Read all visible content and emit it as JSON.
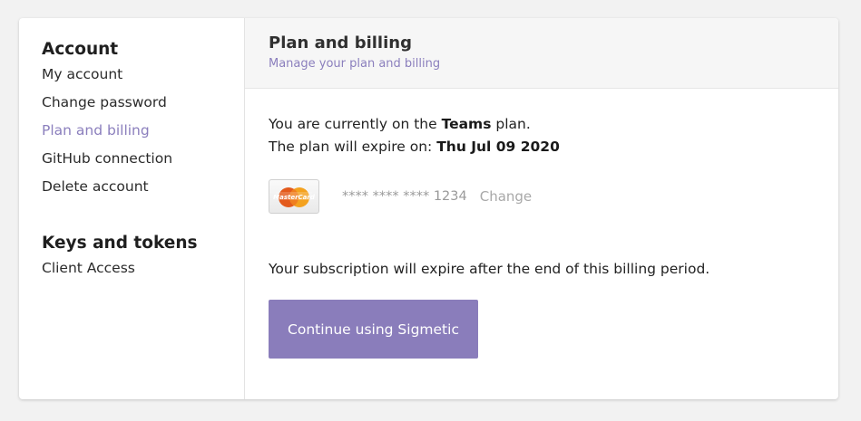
{
  "sidebar": {
    "account_heading": "Account",
    "account_items": [
      "My account",
      "Change password",
      "Plan and billing",
      "GitHub connection",
      "Delete account"
    ],
    "active_item": "Plan and billing",
    "keys_heading": "Keys and tokens",
    "keys_items": [
      "Client Access"
    ]
  },
  "main": {
    "title": "Plan and billing",
    "subtitle": "Manage your plan and billing",
    "plan_prefix": "You are currently on the ",
    "plan_name": "Teams",
    "plan_suffix": " plan.",
    "expire_prefix": "The plan will expire on: ",
    "expire_date": "Thu Jul 09 2020",
    "card_brand_text": "MasterCard",
    "card_number": "**** **** **** 1234",
    "card_change": "Change",
    "subscription_msg": "Your subscription will expire after the end of this billing period.",
    "cta_label": "Continue using Sigmetic"
  },
  "colors": {
    "accent": "#8a7dbb",
    "active_link": "#8b7fbd",
    "page_bg": "#f2f2f2",
    "header_bg": "#f6f6f6"
  },
  "icons": {
    "card": "mastercard-icon"
  }
}
